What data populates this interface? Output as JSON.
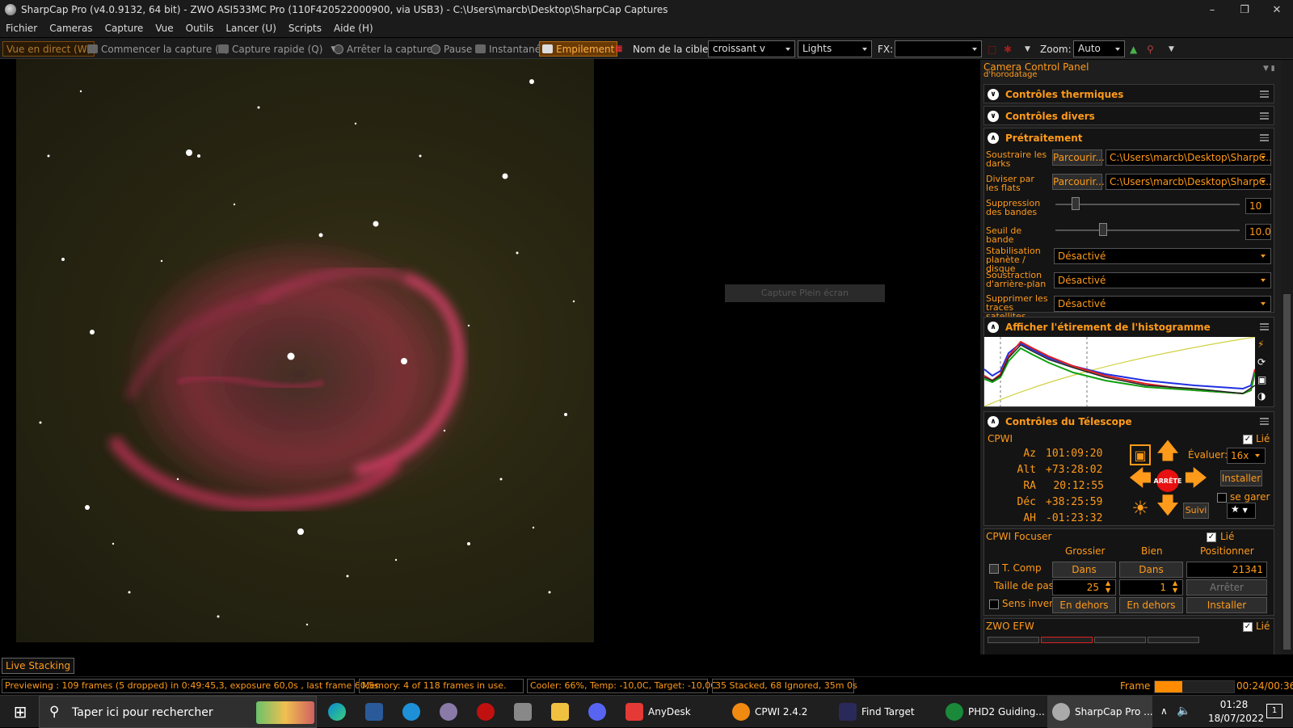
{
  "window": {
    "title": "SharpCap Pro (v4.0.9132, 64 bit) - ZWO ASI533MC Pro (110F420522000900, via USB3) - C:\\Users\\marcb\\Desktop\\SharpCap Captures"
  },
  "menu": [
    "Fichier",
    "Cameras",
    "Capture",
    "Vue",
    "Outils",
    "Lancer (U)",
    "Scripts",
    "Aide (H)"
  ],
  "toolbar": {
    "live_view": "Vue en direct (W)",
    "start_capture": "Commencer la capture (S)",
    "quick_capture": "Capture rapide (Q)",
    "stop_capture": "Arrêter la capture",
    "pause": "Pause",
    "snapshot": "Instantané",
    "stacking": "Empilement",
    "target_label": "Nom de la cible:",
    "target_value": "croissant v",
    "frame_type": "Lights",
    "fx_label": "FX:",
    "fx_value": "",
    "zoom_label": "Zoom:",
    "zoom_value": "Auto"
  },
  "viewport": {
    "fullscreen_label": "Capture Plein écran"
  },
  "panel": {
    "title": "Camera Control Panel",
    "cut_label": "d'horodatage",
    "thermal": "Contrôles thermiques",
    "misc": "Contrôles divers",
    "preprocess": {
      "title": "Prétraitement",
      "darks_label": "Soustraire les darks",
      "darks_btn": "Parcourir...",
      "darks_path": "C:\\Users\\marcb\\Desktop\\SharpC...",
      "flats_label": "Diviser par les flats",
      "flats_btn": "Parcourir...",
      "flats_path": "C:\\Users\\marcb\\Desktop\\SharpC...",
      "banding_label": "Suppression des bandes",
      "banding_value": "10",
      "band_thresh_label": "Seuil de bande",
      "band_thresh_value": "10.0",
      "stab_label": "Stabilisation planète / disque",
      "stab_value": "Désactivé",
      "bg_label": "Soustraction d'arrière-plan",
      "bg_value": "Désactivé",
      "sat_label": "Supprimer les traces satellites",
      "sat_value": "Désactivé"
    },
    "histogram": {
      "title": "Afficher l'étirement de l'histogramme"
    },
    "telescope": {
      "title": "Contrôles du Télescope",
      "mount": "CPWI",
      "linked": "Lié",
      "coords": [
        {
          "k": "Az",
          "v": "101:09:20"
        },
        {
          "k": "Alt",
          "v": "+73:28:02"
        },
        {
          "k": "RA",
          "v": "20:12:55"
        },
        {
          "k": "Déc",
          "v": "+38:25:59"
        },
        {
          "k": "AH",
          "v": "-01:23:32"
        }
      ],
      "stop": "ARRÊTE",
      "rate_label": "Évaluer:",
      "rate_value": "16x",
      "install": "Installer",
      "park": "se garer",
      "track": "Suivi"
    },
    "focuser": {
      "title": "CPWI Focuser",
      "linked": "Lié",
      "col_coarse": "Grossier",
      "col_fine": "Bien",
      "col_pos": "Positionner",
      "tcomp": "T. Comp",
      "in1": "Dans",
      "in2": "Dans",
      "position": "21341",
      "step_label": "Taille de pas",
      "step1": "25",
      "step2": "1",
      "stop": "Arrêter",
      "reverse": "Sens invers",
      "out1": "En dehors",
      "out2": "En dehors",
      "install": "Installer"
    },
    "efw": {
      "title": "ZWO EFW",
      "linked": "Lié"
    }
  },
  "live_stacking": "Live Stacking",
  "status": {
    "preview": "Previewing : 109 frames (5 dropped) in 0:49:45,3, exposure 60,0s , last frame 60,5s",
    "memory": "Memory: 4 of 118 frames in use.",
    "cooler": "Cooler: 66%, Temp: -10,0C, Target: -10,0C",
    "stacked": "35 Stacked, 68 Ignored, 35m 0s",
    "frame_label": "Frame :",
    "time": "00:24/00:36",
    "frame_progress": 0.35
  },
  "taskbar": {
    "search": "Taper ici pour rechercher",
    "apps": [
      "AnyDesk",
      "CPWI 2.4.2",
      "Find Target",
      "PHD2 Guiding...",
      "SharpCap Pro ..."
    ],
    "clock_time": "01:28",
    "clock_date": "18/07/2022",
    "notif_count": "1"
  },
  "colors": {
    "accent": "#ff9a1a",
    "panel_bg": "#1e1e1e",
    "nebula": "#c8325a"
  }
}
